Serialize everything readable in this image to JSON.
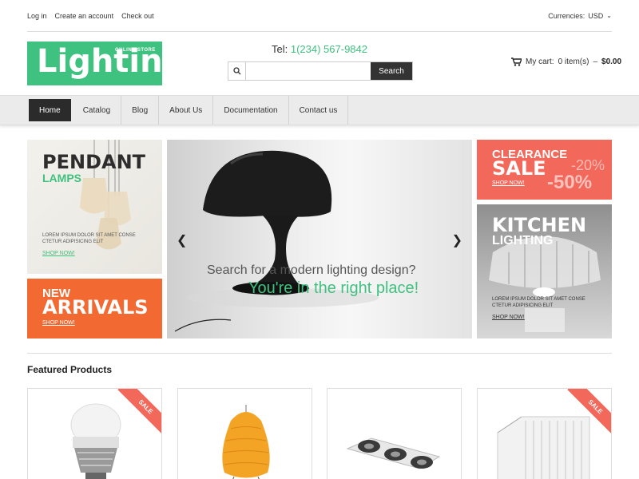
{
  "topbar": {
    "links": [
      "Log in",
      "Create an account",
      "Check out"
    ],
    "currency_label": "Currencies:",
    "currency_value": "USD"
  },
  "logo": {
    "text": "Lighting",
    "tagline": "ONLINE STORE"
  },
  "contact": {
    "tel_label": "Tel:",
    "tel_number": "1(234) 567-9842"
  },
  "search": {
    "placeholder": "",
    "button": "Search"
  },
  "cart": {
    "label": "My cart:",
    "items": "0 item(s)",
    "sep": " – ",
    "total": "$0.00"
  },
  "nav": {
    "items": [
      "Home",
      "Catalog",
      "Blog",
      "About Us",
      "Documentation",
      "Contact us"
    ],
    "active": "Home"
  },
  "banners": {
    "pendant": {
      "title1": "PENDANT",
      "title2": "LAMPS",
      "text": "LOREM IPSUM DOLOR SIT AMET CONSE CTETUR ADIPISICING ELIT",
      "shop": "SHOP NOW!"
    },
    "new": {
      "title1": "NEW",
      "title2": "ARRIVALS",
      "shop": "SHOP NOW!"
    },
    "slider": {
      "line1": "Search for a modern lighting design?",
      "line2": "You're in the right place!"
    },
    "clearance": {
      "title1": "CLEARANCE",
      "title2": "SALE",
      "pct1": "-20%",
      "pct2": "-50%",
      "shop": "SHOP NOW!"
    },
    "kitchen": {
      "title1": "KITCHEN",
      "title2": "LIGHTING",
      "text": "LOREM IPSUM DOLOR SIT AMET CONSE CTETUR ADIPISICING ELIT",
      "shop": "SHOP NOW!"
    }
  },
  "featured": {
    "heading": "Featured Products",
    "sale_label": "SALE"
  },
  "colors": {
    "accent": "#3fc17f",
    "sale": "#f2685a",
    "orange": "#f26a32",
    "dark": "#2b2b2b"
  }
}
